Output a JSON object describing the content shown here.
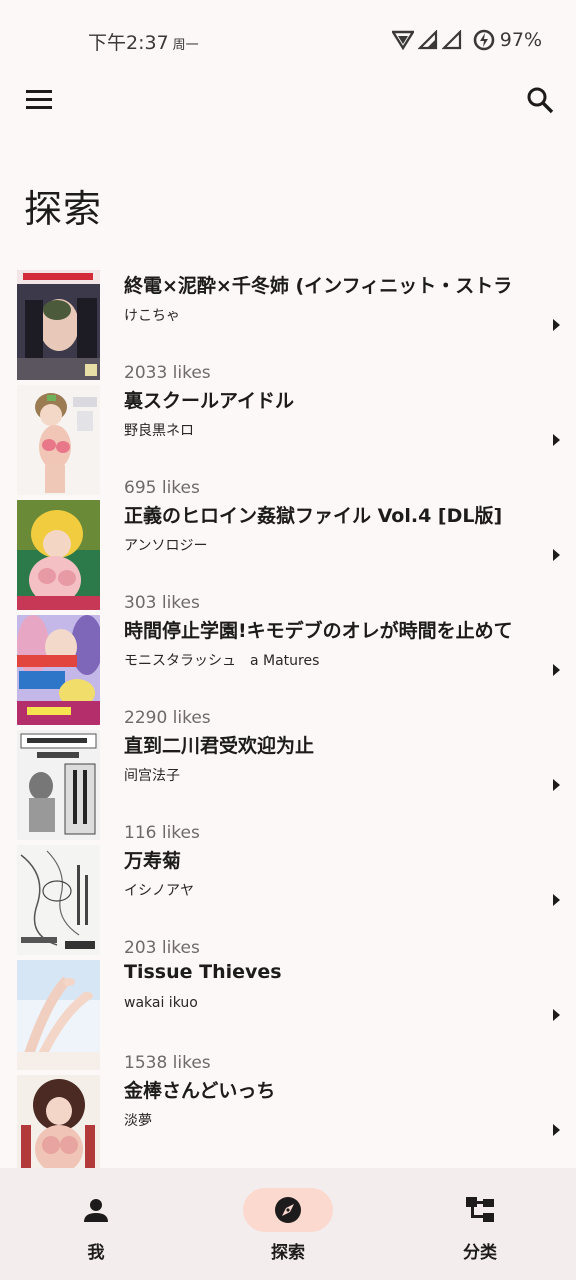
{
  "status": {
    "time": "下午2:37",
    "weekday": "周一",
    "battery": "97%"
  },
  "app_bar": {
    "menu_icon": "menu-icon",
    "search_icon": "search-icon"
  },
  "page_title": "探索",
  "items": [
    {
      "title": "終電×泥酔×千冬姉 (インフィニット・ストラ",
      "author": "けこちゃ",
      "likes": "2033 likes"
    },
    {
      "title": "裏スクールアイドル",
      "author": "野良黒ネロ",
      "likes": "695 likes"
    },
    {
      "title": "正義のヒロイン姦獄ファイル Vol.4 [DL版]",
      "author": "アンソロジー",
      "likes": "303 likes"
    },
    {
      "title": "時間停止学園!キモデブのオレが時間を止めて",
      "author": "モニスタラッシュ　a Matures",
      "likes": "2290 likes"
    },
    {
      "title": "直到二川君受欢迎为止",
      "author": "间宫法子",
      "likes": "116 likes"
    },
    {
      "title": "万寿菊",
      "author": "イシノアヤ",
      "likes": "203 likes"
    },
    {
      "title": " Tissue Thieves",
      "author": "wakai ikuo",
      "likes": "1538 likes"
    },
    {
      "title": "金棒さんどいっち",
      "author": "淡夢",
      "likes": ""
    }
  ],
  "nav": [
    {
      "label": "我",
      "icon": "person-icon"
    },
    {
      "label": "探索",
      "icon": "compass-icon"
    },
    {
      "label": "分类",
      "icon": "category-icon"
    }
  ],
  "colors": {
    "background": "#fdf8f8",
    "nav_background": "#f4eded",
    "nav_active_pill": "#fbd9cf",
    "likes_text": "#6f6a6a"
  }
}
